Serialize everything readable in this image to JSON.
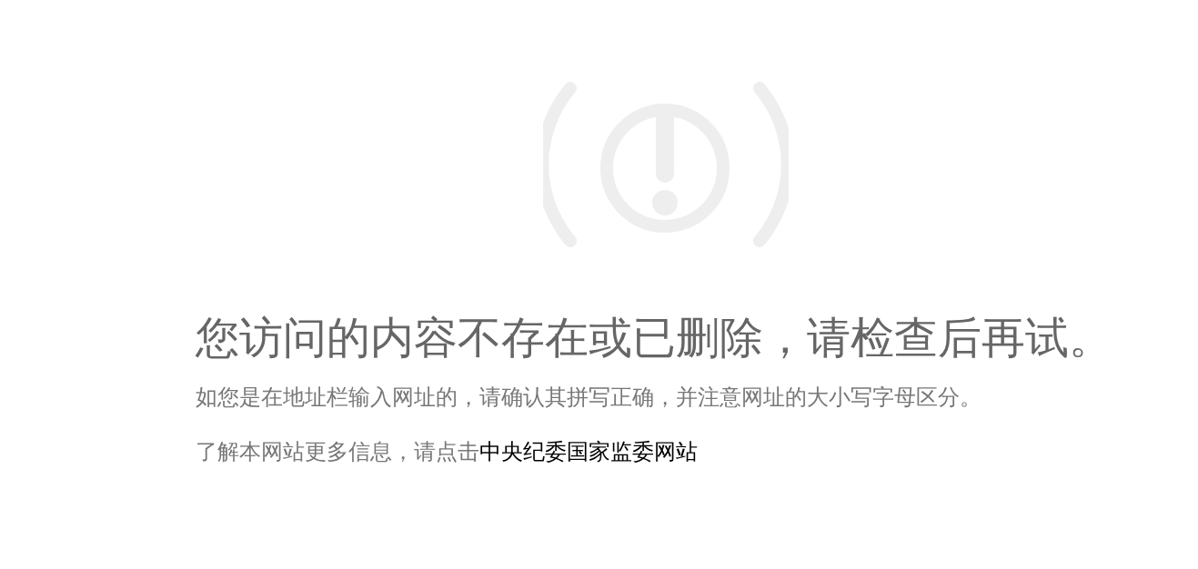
{
  "error": {
    "title": "您访问的内容不存在或已删除，请检查后再试。",
    "hint": "如您是在地址栏输入网址的，请确认其拼写正确，并注意网址的大小写字母区分。",
    "more_info": {
      "text": "了解本网站更多信息，请点击",
      "link": "中央纪委国家监委网站"
    }
  }
}
